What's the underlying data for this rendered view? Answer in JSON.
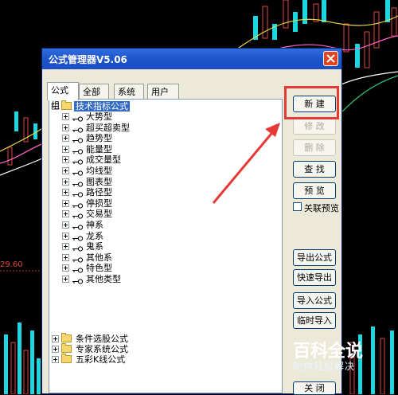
{
  "window": {
    "title": "公式管理器V5.06"
  },
  "tabs": [
    {
      "label": "公式组"
    },
    {
      "label": "全部"
    },
    {
      "label": "系统"
    },
    {
      "label": "用户"
    }
  ],
  "tree": {
    "root": {
      "label": "技术指标公式"
    },
    "children": [
      {
        "label": "大势型"
      },
      {
        "label": "超买超卖型"
      },
      {
        "label": "趋势型"
      },
      {
        "label": "能量型"
      },
      {
        "label": "成交量型"
      },
      {
        "label": "均线型"
      },
      {
        "label": "图表型"
      },
      {
        "label": "路径型"
      },
      {
        "label": "停损型"
      },
      {
        "label": "交易型"
      },
      {
        "label": "神系"
      },
      {
        "label": "龙系"
      },
      {
        "label": "鬼系"
      },
      {
        "label": "其他系"
      },
      {
        "label": "特色型"
      },
      {
        "label": "其他类型"
      }
    ],
    "groups": [
      {
        "label": "条件选股公式"
      },
      {
        "label": "专家系统公式"
      },
      {
        "label": "五彩K线公式"
      }
    ]
  },
  "buttons": {
    "new": "新 建",
    "modify": "修 改",
    "delete": "删 除",
    "find": "查 找",
    "preview": "预 览",
    "export": "导出公式",
    "quick_export": "快速导出",
    "import": "导入公式",
    "temp_import": "临时导入",
    "close": "关 闭"
  },
  "checkbox": {
    "label": "关联预览",
    "checked": false
  },
  "price_label": "29.60",
  "watermark": {
    "line1": "百科全说",
    "line2": "助你轻松解决"
  },
  "colors": {
    "highlight": "#e53935",
    "selection": "#316ac5",
    "titlebar": "#1d52c8"
  }
}
